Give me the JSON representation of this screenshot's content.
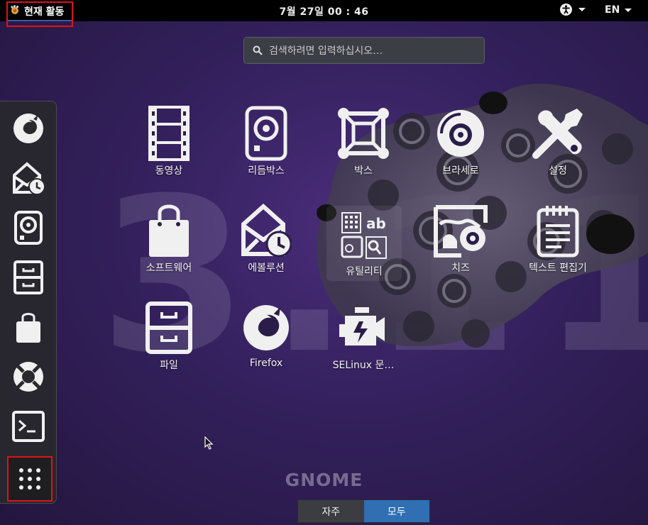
{
  "topbar": {
    "activities_label": "현재 활동",
    "clock": "7월 27일  00 : 46",
    "accessibility_icon": "accessibility-icon",
    "language": "EN"
  },
  "search": {
    "placeholder": "검색하려면 입력하십시오…",
    "icon": "search-icon"
  },
  "dash": {
    "items": [
      {
        "name": "firefox",
        "icon": "firefox-icon"
      },
      {
        "name": "evolution",
        "icon": "mail-clock-icon"
      },
      {
        "name": "rhythmbox",
        "icon": "speaker-icon"
      },
      {
        "name": "files",
        "icon": "file-cabinet-icon"
      },
      {
        "name": "software",
        "icon": "shopping-bag-icon"
      },
      {
        "name": "help",
        "icon": "lifebuoy-icon"
      },
      {
        "name": "terminal",
        "icon": "terminal-icon"
      },
      {
        "name": "show-applications",
        "icon": "app-grid-icon"
      }
    ]
  },
  "apps": [
    {
      "label": "동영상",
      "icon": "film-icon"
    },
    {
      "label": "리듬박스",
      "icon": "speaker-icon"
    },
    {
      "label": "박스",
      "icon": "boxes-icon"
    },
    {
      "label": "브라세로",
      "icon": "disc-icon"
    },
    {
      "label": "설정",
      "icon": "tools-icon"
    },
    {
      "label": "소프트웨어",
      "icon": "shopping-bag-icon"
    },
    {
      "label": "에볼루션",
      "icon": "mail-clock-icon"
    },
    {
      "label": "유틸리티",
      "icon": "utilities-folder-icon"
    },
    {
      "label": "치즈",
      "icon": "camera-photo-icon"
    },
    {
      "label": "텍스트 편집기",
      "icon": "notepad-icon"
    },
    {
      "label": "파일",
      "icon": "file-cabinet-icon"
    },
    {
      "label": "Firefox",
      "icon": "firefox-icon"
    },
    {
      "label": "SELinux 문…",
      "icon": "selinux-icon"
    }
  ],
  "background": {
    "number": "3.11",
    "brand": "GNOME"
  },
  "switcher": {
    "frequent": "자주",
    "all": "모두",
    "active": "all"
  },
  "colors": {
    "highlight_border": "#e0131b",
    "active_tab": "#2f6fb2",
    "background": "#33205c"
  }
}
